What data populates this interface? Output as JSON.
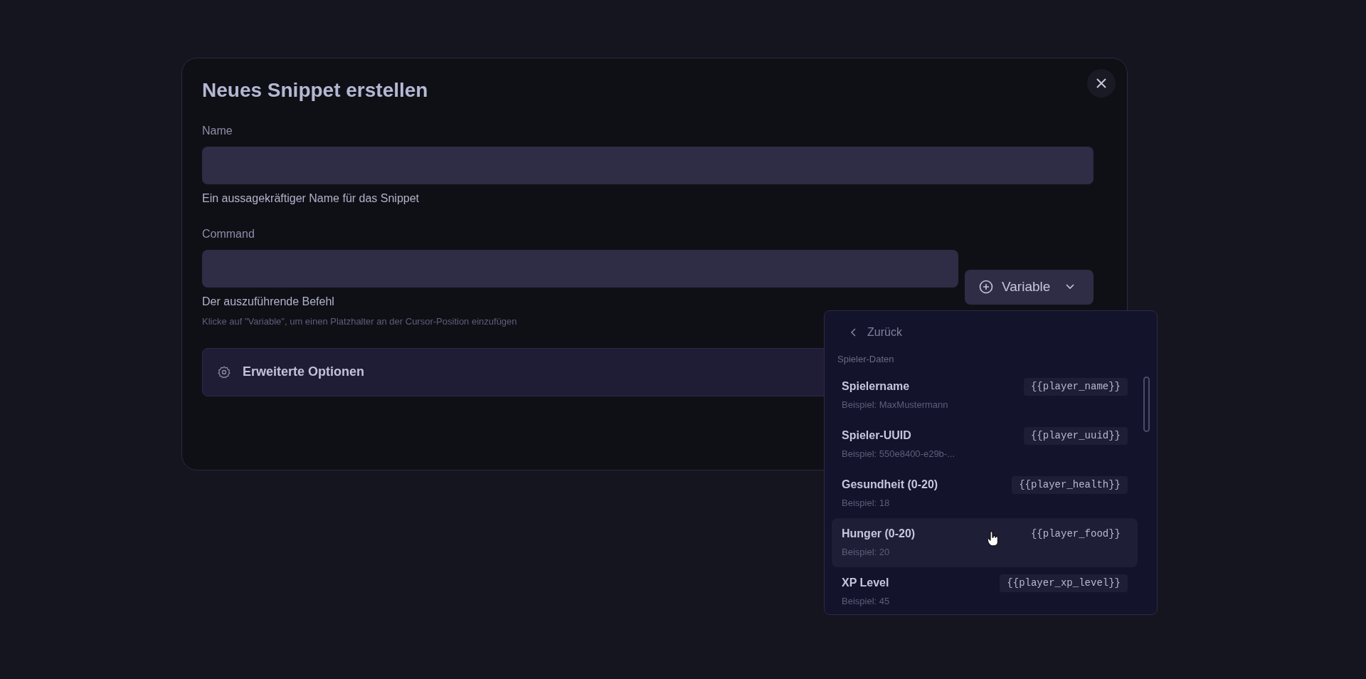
{
  "dialog": {
    "title": "Neues Snippet erstellen"
  },
  "fields": [
    {
      "label": "Name",
      "help": "Ein aussagekräftiger Name für das Snippet"
    },
    {
      "label": "Command",
      "help": "Der auszuführende Befehl",
      "hint": "Klicke auf \"Variable\", um einen Platzhalter an der Cursor-Position einzufügen"
    }
  ],
  "variable_button": {
    "label": "Variable",
    "expanded": true
  },
  "advanced_options": {
    "label": "Erweiterte Optionen"
  },
  "variable_menu": {
    "back": "Zurück",
    "group": "Spieler-Daten",
    "items": [
      {
        "name": "Spielername",
        "example": "Beispiel: MaxMustermann",
        "token": "{{player_name}}",
        "hovered": false
      },
      {
        "name": "Spieler-UUID",
        "example": "Beispiel: 550e8400-e29b-...",
        "token": "{{player_uuid}}",
        "hovered": false
      },
      {
        "name": "Gesundheit (0-20)",
        "example": "Beispiel: 18",
        "token": "{{player_health}}",
        "hovered": false
      },
      {
        "name": "Hunger (0-20)",
        "example": "Beispiel: 20",
        "token": "{{player_food}}",
        "hovered": true
      },
      {
        "name": "XP Level",
        "example": "Beispiel: 45",
        "token": "{{player_xp_level}}",
        "hovered": false
      }
    ]
  }
}
